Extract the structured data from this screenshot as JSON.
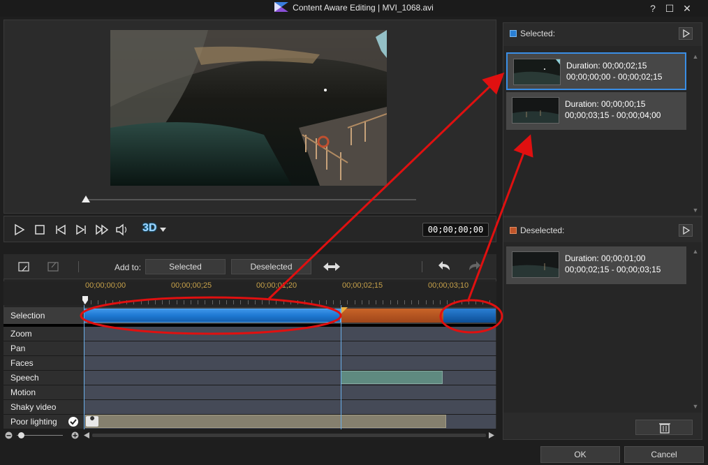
{
  "window": {
    "title": "Content Aware Editing  |  MVI_1068.avi",
    "help_label": "?",
    "maximize_label": "☐",
    "close_label": "✕"
  },
  "player": {
    "timecode": "00;00;00;00",
    "threeD_label": "3D"
  },
  "timeline_toolbar": {
    "add_to_label": "Add to:",
    "selected_btn": "Selected",
    "deselected_btn": "Deselected"
  },
  "ruler": {
    "labels": [
      "00;00;00;00",
      "00;00;00;25",
      "00;00;01;20",
      "00;00;02;15",
      "00;00;03;10"
    ]
  },
  "tracks": [
    {
      "label": "Selection"
    },
    {
      "label": "Zoom"
    },
    {
      "label": "Pan"
    },
    {
      "label": "Faces"
    },
    {
      "label": "Speech"
    },
    {
      "label": "Motion"
    },
    {
      "label": "Shaky video"
    },
    {
      "label": "Poor lighting"
    }
  ],
  "selected_section": {
    "header": "Selected:",
    "color": "#2a7fd4",
    "clips": [
      {
        "duration": "Duration: 00;00;02;15",
        "range": "00;00;00;00 - 00;00;02;15"
      },
      {
        "duration": "Duration: 00;00;00;15",
        "range": "00;00;03;15 - 00;00;04;00"
      }
    ]
  },
  "deselected_section": {
    "header": "Deselected:",
    "color": "#c0552a",
    "clips": [
      {
        "duration": "Duration: 00;00;01;00",
        "range": "00;00;02;15 - 00;00;03;15"
      }
    ]
  },
  "footer": {
    "ok_label": "OK",
    "cancel_label": "Cancel"
  },
  "colors": {
    "selection_blue": "#1e78d2",
    "selection_orange": "#b2521c",
    "annotation_red": "#e01010"
  }
}
